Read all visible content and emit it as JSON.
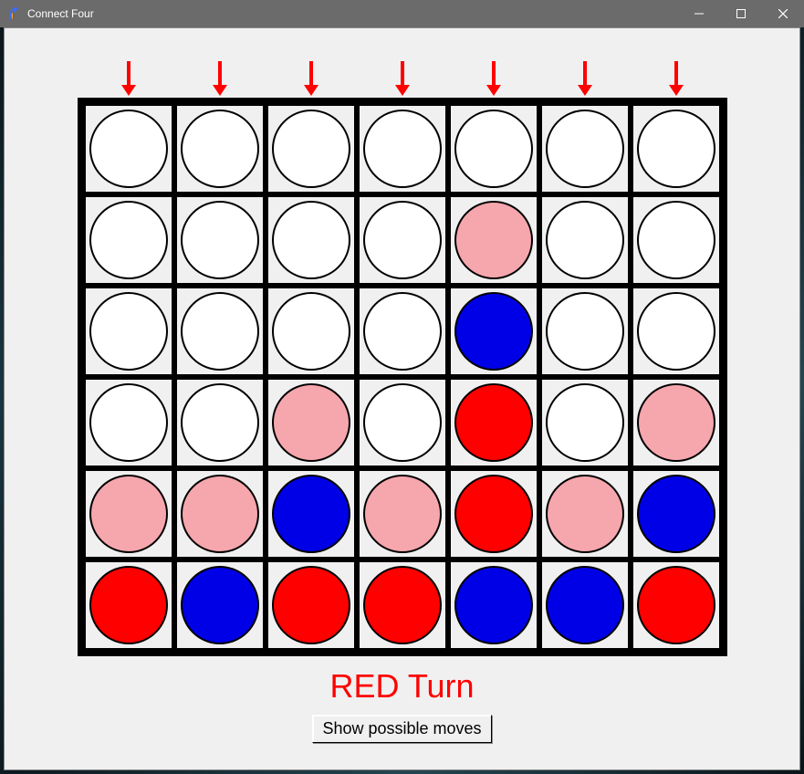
{
  "window": {
    "title": "Connect Four"
  },
  "game": {
    "columns": 7,
    "rows": 6,
    "turn_label": "RED Turn",
    "show_moves_label": "Show possible moves",
    "arrow_color": "#ff0000",
    "colors": {
      "empty": "#ffffff",
      "red": "#ff0000",
      "blue": "#0000e6",
      "pink": "#f6a6ad"
    },
    "board": [
      [
        "empty",
        "empty",
        "empty",
        "empty",
        "empty",
        "empty",
        "empty"
      ],
      [
        "empty",
        "empty",
        "empty",
        "empty",
        "pink",
        "empty",
        "empty"
      ],
      [
        "empty",
        "empty",
        "empty",
        "empty",
        "blue",
        "empty",
        "empty"
      ],
      [
        "empty",
        "empty",
        "pink",
        "empty",
        "red",
        "empty",
        "pink"
      ],
      [
        "pink",
        "pink",
        "blue",
        "pink",
        "red",
        "pink",
        "blue"
      ],
      [
        "red",
        "blue",
        "red",
        "red",
        "blue",
        "blue",
        "red"
      ]
    ]
  }
}
